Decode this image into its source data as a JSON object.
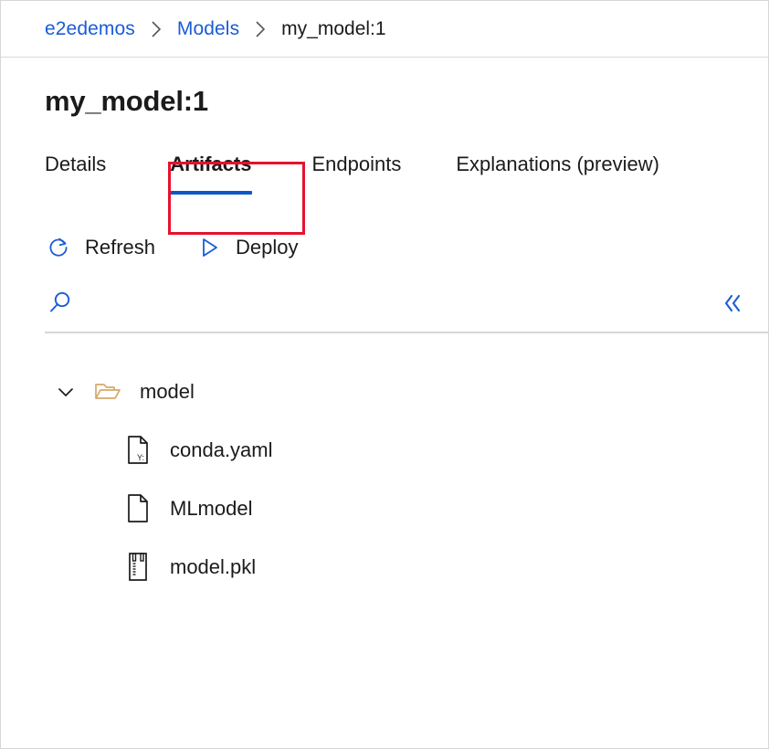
{
  "breadcrumb": {
    "separator_icon": "chevron-right-icon",
    "items": [
      {
        "label": "e2edemos",
        "type": "link"
      },
      {
        "label": "Models",
        "type": "link"
      },
      {
        "label": "my_model:1",
        "type": "current"
      }
    ]
  },
  "page": {
    "title": "my_model:1"
  },
  "tabs": [
    {
      "label": "Details",
      "selected": false
    },
    {
      "label": "Artifacts",
      "selected": true,
      "annotated": true
    },
    {
      "label": "Endpoints",
      "selected": false
    },
    {
      "label": "Explanations (preview)",
      "selected": false
    }
  ],
  "command_bar": [
    {
      "label": "Refresh",
      "icon": "refresh-icon"
    },
    {
      "label": "Deploy",
      "icon": "play-triangle-icon"
    }
  ],
  "search": {
    "icon": "search-icon",
    "value": "",
    "placeholder": "",
    "collapse_icon": "double-chevron-left-icon"
  },
  "tree": [
    {
      "name": "model",
      "type": "folder",
      "expanded": true,
      "chevron_icon": "chevron-down-icon",
      "icon": "folder-open-icon",
      "children": [
        {
          "name": "conda.yaml",
          "type": "file",
          "icon": "yaml-file-icon"
        },
        {
          "name": "MLmodel",
          "type": "file",
          "icon": "blank-file-icon"
        },
        {
          "name": "model.pkl",
          "type": "file",
          "icon": "zip-file-icon"
        }
      ]
    }
  ],
  "colors": {
    "link": "#1a5cd6",
    "tab_underline": "#0b57c7",
    "annotation": "#e8112d",
    "icon_blue": "#1a5cd6",
    "folder": "#d4a96a",
    "text": "#1b1b1b",
    "divider": "#d6d6d6"
  }
}
